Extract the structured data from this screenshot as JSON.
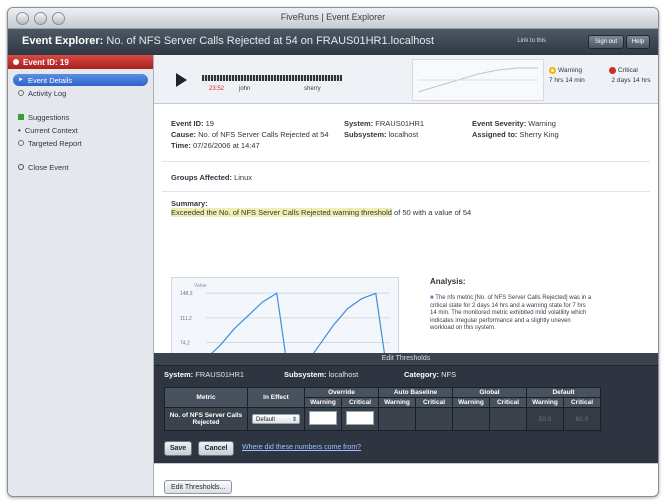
{
  "window_title": "FiveRuns | Event Explorer",
  "header": {
    "title": "Event Explorer:",
    "subtitle": "No. of NFS Server Calls Rejected at 54 on FRAUS01HR1.localhost",
    "link": "Link to this",
    "btn_sign_out": "Sign out",
    "btn_help": "Help"
  },
  "sidebar": {
    "event_id": "Event ID: 19",
    "event_details": "Event Details",
    "activity_log": "Activity Log",
    "suggestions": "Suggestions",
    "current_context": "Current Context",
    "targeted_report": "Targeted Report",
    "close_event": "Close Event"
  },
  "player": {
    "time": "23:52",
    "label1": "john",
    "label2": "sherry",
    "warning_label": "Warning",
    "warning_value": "7 hrs 14 min",
    "critical_label": "Critical",
    "critical_value": "2 days 14 hrs"
  },
  "details": {
    "event_id_label": "Event ID:",
    "event_id_value": "19",
    "cause_label": "Cause:",
    "cause_value": "No. of NFS Server Calls Rejected at 54",
    "time_label": "Time:",
    "time_value": "07/26/2006 at 14:47",
    "system_label": "System:",
    "system_value": "FRAUS01HR1",
    "subsystem_label": "Subsystem:",
    "subsystem_value": "localhost",
    "severity_label": "Event Severity:",
    "severity_value": "Warning",
    "assigned_label": "Assigned to:",
    "assigned_value": "Sherry King",
    "groups_label": "Groups Affected:",
    "groups_value": "Linux",
    "summary_label": "Summary:",
    "summary_text": "Exceeded the No. of NFS Server Calls Rejected warning threshold",
    "summary_tail": "of 50 with a value of 54"
  },
  "analysis": {
    "title": "Analysis:",
    "text": "The nfs metric [No. of NFS Server Calls Rejected] was in a critical state for 2 days 14 hrs and a warning state for 7 hrs 14 min. The monitored metric exhibited mild volatility which indicates irregular performance and a slightly uneven workload on this system."
  },
  "chart_data": {
    "type": "line",
    "title": "",
    "ylabel": "Value",
    "yticks": [
      "148.3",
      "111.2",
      "74.2"
    ],
    "series": [
      {
        "values": [
          50,
          70,
          95,
          115,
          135,
          148,
          0,
          40,
          70,
          100,
          125,
          140,
          148,
          0
        ]
      }
    ]
  },
  "thresholds": {
    "title": "Edit Thresholds",
    "system_label": "System:",
    "system_value": "FRAUS01HR1",
    "subsystem_label": "Subsystem:",
    "subsystem_value": "localhost",
    "category_label": "Category:",
    "category_value": "NFS",
    "col_metric": "Metric",
    "col_in_effect": "In Effect",
    "col_override": "Override",
    "col_auto": "Auto Baseline",
    "col_global": "Global",
    "col_default": "Default",
    "sub_warning": "Warning",
    "sub_critical": "Critical",
    "row_metric": "No. of NFS Server Calls Rejected",
    "row_in_effect": "Default",
    "row_default_warning": "50.0",
    "row_default_critical": "60.0",
    "save": "Save",
    "cancel": "Cancel",
    "link": "Where did these numbers come from?"
  },
  "edit_button": "Edit Thresholds..."
}
